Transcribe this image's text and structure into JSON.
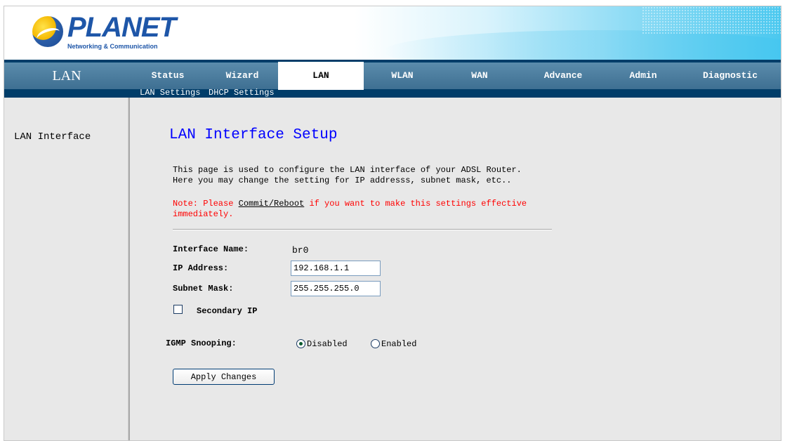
{
  "header": {
    "brand": "PLANET",
    "tagline": "Networking & Communication"
  },
  "nav": {
    "section_title": "LAN",
    "tabs": [
      {
        "label": "Status",
        "active": false
      },
      {
        "label": "Wizard",
        "active": false
      },
      {
        "label": "LAN",
        "active": true
      },
      {
        "label": "WLAN",
        "active": false
      },
      {
        "label": "WAN",
        "active": false
      },
      {
        "label": "Advance",
        "active": false
      },
      {
        "label": "Admin",
        "active": false
      },
      {
        "label": "Diagnostic",
        "active": false
      }
    ],
    "subtabs": [
      "LAN Settings",
      "DHCP Settings"
    ]
  },
  "sidebar": {
    "items": [
      {
        "label": "LAN Interface"
      }
    ]
  },
  "main": {
    "title": "LAN Interface Setup",
    "description_line1": "This page is used to configure the LAN interface of your ADSL Router.",
    "description_line2": "Here you may change the setting for IP addresss, subnet mask, etc..",
    "note_prefix": "Note: Please ",
    "note_link": "Commit/Reboot",
    "note_suffix": " if you want to make this settings effective",
    "note_line2": "immediately.",
    "form": {
      "interface_name_label": "Interface Name:",
      "interface_name_value": "br0",
      "ip_address_label": "IP Address:",
      "ip_address_value": "192.168.1.1",
      "subnet_mask_label": "Subnet Mask:",
      "subnet_mask_value": "255.255.255.0",
      "secondary_ip_label": "Secondary IP",
      "secondary_ip_checked": false,
      "igmp_label": "IGMP Snooping:",
      "igmp_options": [
        "Disabled",
        "Enabled"
      ],
      "igmp_selected": "Disabled",
      "apply_label": "Apply Changes"
    }
  },
  "colors": {
    "nav_bar": "#4a7b9d",
    "subnav_bar": "#013d69",
    "title_blue": "#0000ff",
    "note_red": "#ff0000"
  }
}
